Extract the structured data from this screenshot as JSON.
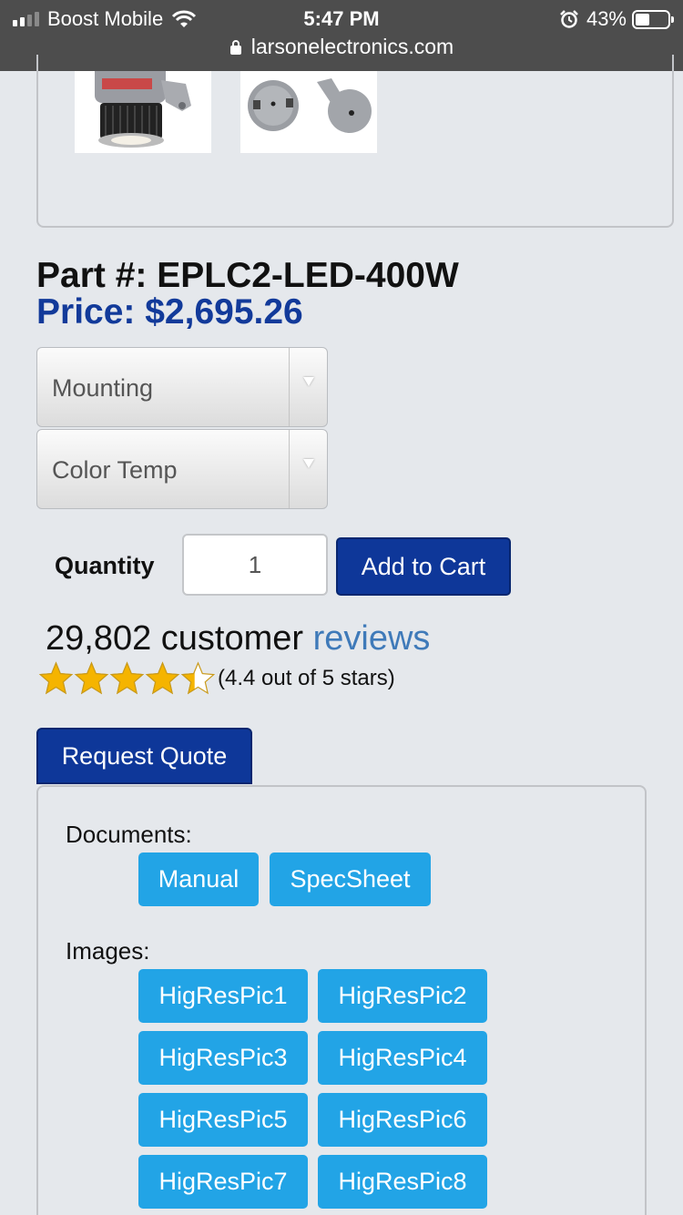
{
  "status_bar": {
    "carrier": "Boost Mobile",
    "time": "5:47 PM",
    "battery": "43%",
    "battery_level": 0.43,
    "url": "larsonelectronics.com"
  },
  "gallery": {
    "thumbnails": [
      "fixture-thumbnail",
      "bracket-thumbnail"
    ]
  },
  "product": {
    "part": "Part #: EPLC2-LED-400W",
    "price": "Price: $2,695.26"
  },
  "options": {
    "mounting": "Mounting",
    "color_temp": "Color Temp"
  },
  "purchase": {
    "quantity_label": "Quantity",
    "quantity_value": "1",
    "add_to_cart": "Add to Cart"
  },
  "reviews": {
    "count_text": "29,802 customer",
    "link_text": "reviews",
    "rating_text": "(4.4 out of 5 stars)",
    "rating": 4.4,
    "max": 5
  },
  "quote": {
    "label": "Request Quote"
  },
  "documents": {
    "label": "Documents:",
    "buttons": [
      "Manual",
      "SpecSheet"
    ]
  },
  "images": {
    "label": "Images:",
    "buttons": [
      "HigResPic1",
      "HigResPic2",
      "HigResPic3",
      "HigResPic4",
      "HigResPic5",
      "HigResPic6",
      "HigResPic7",
      "HigResPic8"
    ]
  },
  "colors": {
    "primary_button": "#0e3799",
    "price": "#123a9a",
    "link": "#3f7ab9",
    "doc_button": "#22a4e6",
    "star": "#f5b400"
  }
}
